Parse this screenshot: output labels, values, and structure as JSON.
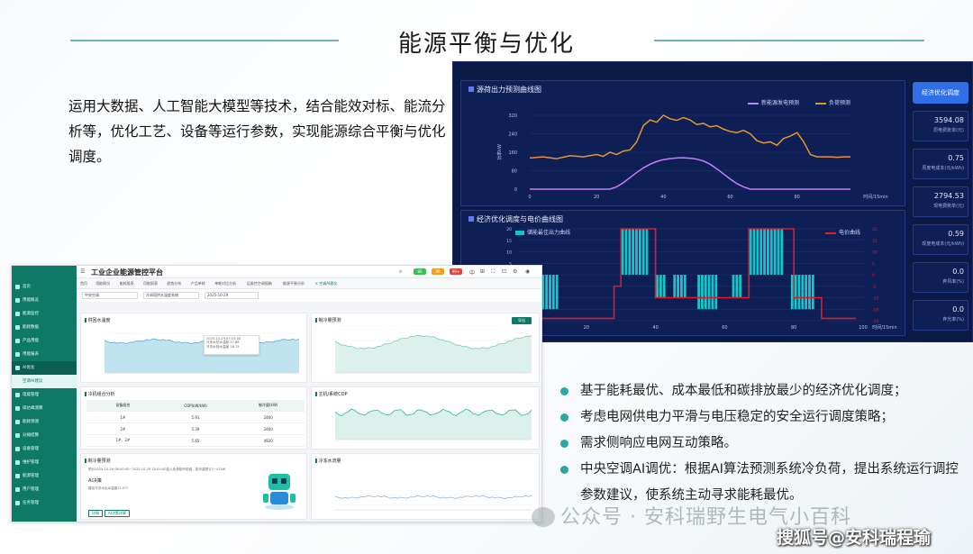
{
  "slide": {
    "title": "能源平衡与优化",
    "intro": "运用大数据、人工智能大模型等技术，结合能效对标、能流分析等，优化工艺、设备等运行参数，实现能源综合平衡与优化调度。",
    "bullets": [
      "基于能耗最优、成本最低和碳排放最少的经济优化调度；",
      "考虑电网供电力平滑与电压稳定的安全运行调度策略；",
      "需求侧响应电网互动策略。",
      "中央空调AI调优：根据AI算法预测系统冷负荷，提出系统运行调控参数建议，使系统主动寻求能耗最优。"
    ],
    "watermark": "公众号 · 安科瑞野生电气小百科",
    "watermark2": "搜狐号@安科瑞程瑜",
    "colors": {
      "accent": "#2aa7a0",
      "dark_bg": "#0b1a46",
      "sidebar": "#0e7a66"
    }
  },
  "optimizer": {
    "button": "经济优化调度",
    "kpis": [
      {
        "value": "3594.08",
        "label": "原电费账单(元)"
      },
      {
        "value": "0.75",
        "label": "原度电成本(元/kWh)"
      },
      {
        "value": "2794.53",
        "label": "现电费账单(元)"
      },
      {
        "value": "0.59",
        "label": "现度电成本(元/kWh)"
      },
      {
        "value": "0.0",
        "label": "弃风率(%)"
      },
      {
        "value": "0.0",
        "label": "弃光率(%)"
      }
    ],
    "chart1": {
      "title": "源荷出力预测曲线图",
      "ylabel": "功率kW",
      "xlabel": "时间/15min",
      "legend": [
        "新能源发电预测",
        "负荷预测"
      ],
      "yticks": [
        "0",
        "80",
        "160",
        "240",
        "320"
      ],
      "xticks": [
        "0",
        "20",
        "40",
        "60",
        "80"
      ]
    },
    "chart2": {
      "title": "经济优化调度与电价曲线图",
      "legend_left": "储能最佳出力曲线",
      "legend_right": "电价曲线",
      "xlabel": "时间/15min",
      "yticks": [
        "20",
        "15",
        "10",
        "5",
        "0",
        "-5",
        "-10",
        "-15",
        "-20"
      ],
      "xticks": [
        "0",
        "20",
        "40",
        "60",
        "80",
        "100"
      ]
    }
  },
  "chart_data": [
    {
      "type": "line",
      "title": "源荷出力预测曲线图",
      "xlabel": "时间/15min",
      "ylabel": "功率kW",
      "xlim": [
        0,
        96
      ],
      "ylim": [
        0,
        320
      ],
      "series": [
        {
          "name": "新能源发电预测",
          "color": "#c77dff",
          "x": [
            0,
            24,
            26,
            28,
            30,
            32,
            34,
            36,
            38,
            40,
            42,
            44,
            46,
            48,
            50,
            52,
            54,
            56,
            58,
            60,
            62,
            64,
            66,
            70,
            96
          ],
          "y": [
            0,
            0,
            10,
            28,
            50,
            72,
            92,
            108,
            120,
            128,
            132,
            135,
            136,
            134,
            130,
            122,
            108,
            88,
            66,
            44,
            24,
            10,
            0,
            0,
            0
          ]
        },
        {
          "name": "负荷预测",
          "color": "#e6962e",
          "x": [
            0,
            4,
            8,
            12,
            16,
            20,
            22,
            24,
            26,
            28,
            30,
            32,
            34,
            36,
            38,
            40,
            42,
            44,
            46,
            48,
            50,
            52,
            54,
            56,
            58,
            60,
            62,
            64,
            66,
            68,
            70,
            72,
            74,
            76,
            78,
            80,
            82,
            84,
            86,
            88,
            90,
            92,
            94,
            96
          ],
          "y": [
            135,
            140,
            132,
            145,
            140,
            150,
            142,
            160,
            150,
            165,
            170,
            205,
            275,
            300,
            290,
            320,
            305,
            298,
            310,
            300,
            280,
            285,
            270,
            275,
            260,
            250,
            245,
            255,
            240,
            210,
            200,
            205,
            190,
            220,
            230,
            245,
            205,
            150,
            140,
            140,
            140,
            138,
            140,
            140
          ]
        }
      ]
    },
    {
      "type": "bar",
      "title": "经济优化调度与电价曲线图",
      "xlabel": "时间/15min",
      "xlim": [
        0,
        100
      ],
      "ylim": [
        -20,
        20
      ],
      "series": [
        {
          "name": "储能最佳出力曲线",
          "color": "#17c3c8",
          "values": [
            -15,
            -15,
            -15,
            -15,
            -15,
            -15,
            -15,
            -15,
            -15,
            -15,
            -15,
            -15,
            0,
            0,
            0,
            0,
            0,
            0,
            0,
            0,
            0,
            0,
            0,
            0,
            0,
            0,
            0,
            0,
            0,
            0,
            20,
            20,
            20,
            20,
            20,
            20,
            20,
            20,
            0,
            0,
            -10,
            -10,
            -10,
            0,
            0,
            -10,
            -10,
            -10,
            -10,
            0,
            0,
            0,
            -15,
            -15,
            -15,
            -15,
            -15,
            -15,
            0,
            0,
            0,
            0,
            -10,
            -10,
            -10,
            0,
            0,
            20,
            20,
            20,
            20,
            20,
            20,
            20,
            20,
            20,
            20,
            0,
            0,
            -15,
            -15,
            -15,
            -15,
            -15,
            -15,
            -15,
            0,
            0,
            0,
            0,
            0,
            0,
            0,
            0,
            0,
            0
          ]
        },
        {
          "name": "电价曲线",
          "color": "#e01b2a",
          "values": [
            -19,
            -19,
            -19,
            -19,
            -19,
            -19,
            -19,
            -19,
            -19,
            -19,
            -19,
            -19,
            -19,
            -19,
            -19,
            -19,
            -19,
            -19,
            -19,
            -19,
            -19,
            -19,
            -19,
            -19,
            -19,
            -19,
            -19,
            -19,
            -5,
            -5,
            20,
            20,
            20,
            20,
            20,
            20,
            20,
            20,
            20,
            20,
            -10,
            -10,
            -10,
            -10,
            -10,
            -10,
            -10,
            -10,
            -10,
            -10,
            -10,
            -10,
            -10,
            -10,
            -10,
            -10,
            -10,
            -10,
            -10,
            -10,
            -10,
            -10,
            -10,
            -10,
            -10,
            -10,
            -10,
            20,
            20,
            20,
            20,
            20,
            20,
            20,
            20,
            20,
            20,
            20,
            20,
            20,
            -10,
            -10,
            -10,
            -10,
            -10,
            -10,
            -10,
            -10,
            -19,
            -19,
            -19,
            -19,
            -19,
            -19,
            -19,
            -19,
            -19,
            -19
          ]
        }
      ]
    }
  ],
  "dashboard": {
    "title": "工业企业能源管控平台",
    "sidebar": [
      "首页",
      "用能概览",
      "能源监控",
      "能耗数据",
      "产品用能",
      "用能报表",
      "AI优化",
      "空调AI建议",
      "电能管理",
      "碳达峰测算",
      "能耗预测",
      "分摊结算",
      "设备管理",
      "维护管理",
      "能源管理",
      "用户管理",
      "任务管理"
    ],
    "tabs": [
      "首页",
      "用能概况",
      "能耗报表",
      "用能报表",
      "趋势分析",
      "产品单耗",
      "单耗对比分析",
      "运维控空调报箱",
      "能源平衡分析",
      "× 空调AI建议"
    ],
    "filters": [
      "中央空调",
      "冷却塔供水温度系统",
      "2025-10-29"
    ],
    "badges": [
      "66",
      "99",
      "99+"
    ],
    "cards": {
      "c1": "供回水温度",
      "c2": "制冷量预测",
      "c3": "冷机组合分析",
      "c4": "主机/系统COP",
      "c5": "制冷量预测",
      "c6": "冷冻水流量"
    },
    "c2_button": "导出",
    "table": {
      "headers": [
        "设备组合",
        "COP(kW/kW)",
        "制冷量(kW)"
      ],
      "rows": [
        [
          "1#",
          "5.91",
          "2460"
        ],
        [
          "2#",
          "5.39",
          "2460"
        ],
        [
          "1#、2#",
          "5.65",
          "4920"
        ]
      ]
    },
    "tooltip": [
      "2025-10-29 05:15:00",
      "冷冻水供水温度  27.86",
      "冷冻水回水温度  28.75"
    ],
    "ai_text": "预计2025-10-29 08:00:00~2025-10-29 10:00:00投入负荷制冷机组，制冷量预计2~47kW",
    "ai_title": "AI决策",
    "ai_sub": "建议冷冻水出水温度11.0°C",
    "ai_buttons": [
      "详情",
      "AI决策详情"
    ]
  }
}
